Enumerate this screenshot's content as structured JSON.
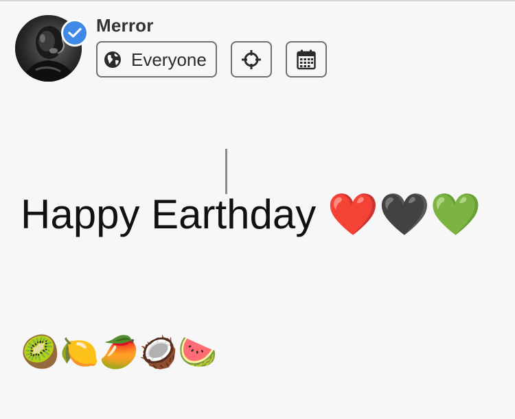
{
  "user": {
    "name": "Merror",
    "verified": true
  },
  "controls": {
    "audience_label": "Everyone",
    "audience_icon": "globe-icon",
    "location_icon": "crosshair-icon",
    "schedule_icon": "calendar-icon"
  },
  "post": {
    "line1": "Happy Earthday ❤️🖤💚",
    "line2": "🥝🍋🥭🥥🍉"
  },
  "colors": {
    "badge": "#3f8ae6",
    "border": "#6f6f6f",
    "background": "#f7f7f7"
  }
}
